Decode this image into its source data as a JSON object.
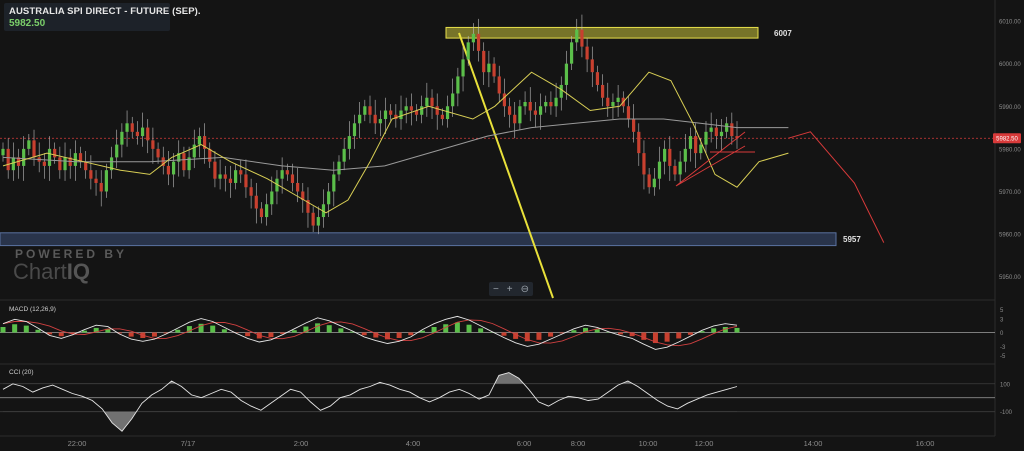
{
  "header": {
    "title": "AUSTRALIA SPI DIRECT - FUTURE (SEP).",
    "price": "5982.50"
  },
  "watermark": {
    "line1": "POWERED BY",
    "line2a": "Chart",
    "line2b": "IQ"
  },
  "zoom_controls": {
    "minus": "−",
    "plus": "+",
    "reset": "⊖"
  },
  "colors": {
    "background": "#141414",
    "up_candle": "#5bbf4a",
    "down_candle": "#c8402f",
    "fast_ma": "#d9cf55",
    "slow_ma": "#9a9a9a",
    "resistance_zone": "#c9c23a",
    "support_zone": "#3b4f78",
    "current_price": "#d83a3a",
    "trendline": "#e8e03a"
  },
  "chart_data": [
    {
      "type": "candlestick",
      "name": "price-panel",
      "ylim": [
        5945,
        6014
      ],
      "y_ticks": [
        "6010.00",
        "6000.00",
        "5990.00",
        "5980.00",
        "5970.00",
        "5960.00",
        "5950.00"
      ],
      "x_ticks": [
        "22:00",
        "7/17",
        "2:00",
        "4:00",
        "6:00",
        "8:00",
        "10:00",
        "12:00",
        "14:00",
        "16:00"
      ],
      "current_price": 5982.5,
      "current_price_label": "5982.50",
      "resistance": {
        "value": 6007,
        "label": "6007",
        "y_range": [
          6006.0,
          6008.5
        ]
      },
      "support": {
        "value": 5957,
        "label": "5957",
        "y_range": [
          5957.3,
          5960.3
        ]
      },
      "close_series": [
        5980,
        5975,
        5978,
        5976,
        5980,
        5982,
        5978,
        5977,
        5976,
        5980,
        5978,
        5975,
        5978,
        5976,
        5979,
        5977,
        5975,
        5973,
        5972,
        5970,
        5975,
        5978,
        5981,
        5984,
        5986,
        5984,
        5983,
        5985,
        5982,
        5980,
        5978,
        5976,
        5974,
        5977,
        5979,
        5975,
        5978,
        5981,
        5983,
        5980,
        5977,
        5973,
        5974,
        5973,
        5972,
        5975,
        5974,
        5971,
        5969,
        5966,
        5964,
        5967,
        5970,
        5973,
        5975,
        5974,
        5972,
        5970,
        5968,
        5965,
        5962,
        5964,
        5967,
        5970,
        5974,
        5977,
        5980,
        5983,
        5986,
        5988,
        5990,
        5988,
        5986,
        5987,
        5989,
        5988,
        5987,
        5989,
        5990,
        5989,
        5988,
        5990,
        5992,
        5990,
        5988,
        5987,
        5990,
        5993,
        5997,
        6001,
        6005,
        6007,
        6003,
        5998,
        6000,
        5997,
        5993,
        5990,
        5988,
        5986,
        5990,
        5991,
        5989,
        5988,
        5990,
        5991,
        5990,
        5992,
        5995,
        6000,
        6005,
        6008,
        6004,
        6001,
        5998,
        5995,
        5992,
        5990,
        5991,
        5992,
        5990,
        5987,
        5984,
        5979,
        5974,
        5971,
        5973,
        5977,
        5980,
        5976,
        5974,
        5977,
        5980,
        5983,
        5979,
        5981,
        5984,
        5985,
        5983,
        5984,
        5986,
        5983,
        5982.5
      ],
      "fast_ma": [
        [
          0.0,
          5976
        ],
        [
          0.06,
          5979
        ],
        [
          0.11,
          5977
        ],
        [
          0.16,
          5975
        ],
        [
          0.2,
          5974
        ],
        [
          0.23,
          5978
        ],
        [
          0.27,
          5981
        ],
        [
          0.31,
          5977
        ],
        [
          0.36,
          5973
        ],
        [
          0.41,
          5968
        ],
        [
          0.44,
          5965
        ],
        [
          0.47,
          5968
        ],
        [
          0.5,
          5977
        ],
        [
          0.53,
          5987
        ],
        [
          0.58,
          5990
        ],
        [
          0.64,
          5987
        ],
        [
          0.67,
          5990
        ],
        [
          0.72,
          5998
        ],
        [
          0.76,
          5994
        ],
        [
          0.8,
          5989
        ],
        [
          0.84,
          5990
        ],
        [
          0.88,
          5998
        ],
        [
          0.91,
          5996
        ],
        [
          0.94,
          5986
        ],
        [
          0.97,
          5974
        ],
        [
          1.0,
          5971
        ],
        [
          1.03,
          5977
        ],
        [
          1.07,
          5979
        ]
      ],
      "slow_ma": [
        [
          0.0,
          5978
        ],
        [
          0.1,
          5977
        ],
        [
          0.2,
          5977
        ],
        [
          0.3,
          5978
        ],
        [
          0.38,
          5976
        ],
        [
          0.45,
          5975
        ],
        [
          0.52,
          5976
        ],
        [
          0.6,
          5980
        ],
        [
          0.66,
          5983
        ],
        [
          0.72,
          5985
        ],
        [
          0.78,
          5986
        ],
        [
          0.84,
          5987
        ],
        [
          0.9,
          5987
        ],
        [
          0.95,
          5986
        ],
        [
          1.0,
          5985
        ],
        [
          1.07,
          5985
        ]
      ],
      "projection": [
        [
          1.07,
          5982.5
        ],
        [
          1.1,
          5984
        ],
        [
          1.13,
          5978
        ],
        [
          1.16,
          5972
        ],
        [
          1.2,
          5958
        ]
      ]
    },
    {
      "type": "histogram+lines",
      "name": "macd-panel",
      "label": "MACD (12,26,9)",
      "ylim": [
        -6,
        6
      ],
      "y_ticks": [
        "5",
        "3",
        "0",
        "-3",
        "-5"
      ],
      "values": [
        1.2,
        1.8,
        1.5,
        0.6,
        -0.4,
        -0.8,
        -0.3,
        0.4,
        1.0,
        0.8,
        -0.2,
        -0.9,
        -1.2,
        -0.9,
        -0.2,
        0.6,
        1.4,
        1.9,
        1.5,
        0.7,
        -0.1,
        -0.8,
        -1.3,
        -1.0,
        -0.3,
        0.5,
        1.3,
        2.0,
        1.6,
        0.9,
        0.2,
        -0.6,
        -1.1,
        -1.5,
        -1.2,
        -0.6,
        0.4,
        1.2,
        1.8,
        2.2,
        1.7,
        0.9,
        0.1,
        -0.7,
        -1.4,
        -1.9,
        -1.6,
        -0.9,
        -0.2,
        0.5,
        1.0,
        0.7,
        0.1,
        -0.4,
        -0.8,
        -1.6,
        -2.3,
        -2.0,
        -1.3,
        -0.5,
        0.3,
        0.9,
        1.2,
        1.0
      ]
    },
    {
      "type": "line-filled",
      "name": "cci-panel",
      "label": "CCI (20)",
      "ylim": [
        -260,
        220
      ],
      "y_ticks": [
        "100",
        "-100"
      ],
      "values": [
        60,
        100,
        80,
        40,
        70,
        90,
        60,
        30,
        10,
        -20,
        -80,
        -180,
        -240,
        -150,
        -40,
        20,
        60,
        120,
        80,
        20,
        0,
        30,
        60,
        40,
        -20,
        -60,
        -90,
        -40,
        10,
        60,
        40,
        -30,
        -90,
        -60,
        0,
        20,
        60,
        80,
        110,
        90,
        60,
        40,
        0,
        -30,
        0,
        40,
        60,
        30,
        -10,
        20,
        160,
        180,
        140,
        60,
        -30,
        -60,
        -20,
        10,
        0,
        -20,
        -10,
        40,
        90,
        120,
        80,
        30,
        -20,
        -60,
        -80,
        -40,
        -10,
        20,
        40,
        60,
        80
      ]
    }
  ]
}
